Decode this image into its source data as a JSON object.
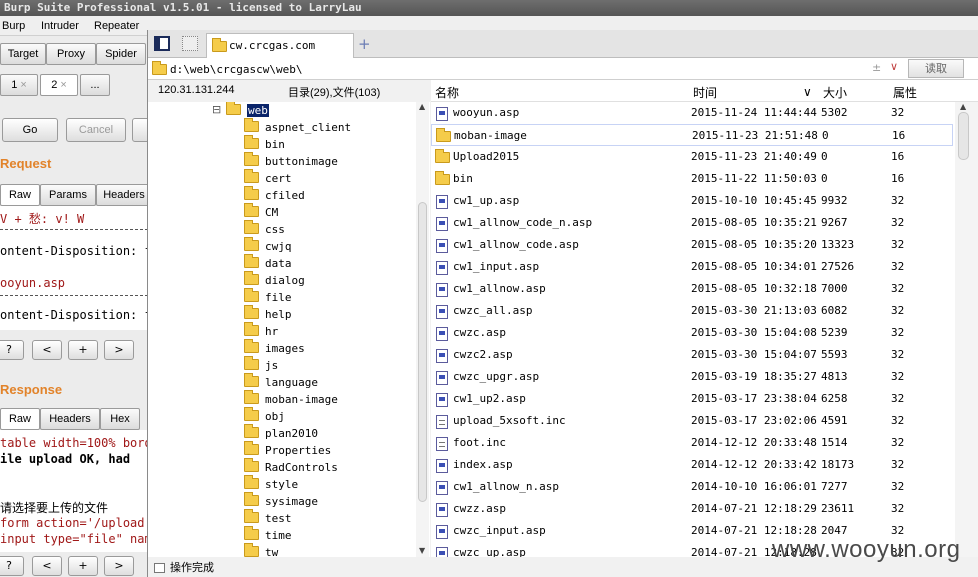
{
  "burp": {
    "title": "Burp Suite Professional v1.5.01 - licensed to LarryLau",
    "menu": [
      "Burp",
      "Intruder",
      "Repeater"
    ],
    "tools": [
      "Target",
      "Proxy",
      "Spider"
    ],
    "repeater_tabs": [
      "1",
      "2",
      "..."
    ],
    "tab_close": "×",
    "go_label": "Go",
    "cancel_label": "Cancel",
    "request_head": "Request",
    "request_tabs": [
      "Raw",
      "Params",
      "Headers"
    ],
    "request_lines": [
      "V   +   愁: v!   W",
      "ontent-Disposition: f",
      "ooyun.asp",
      "ontent-Disposition: f"
    ],
    "nav_buttons": [
      "?",
      "<",
      "+",
      ">"
    ],
    "response_head": "Response",
    "response_tabs": [
      "Raw",
      "Headers",
      "Hex"
    ],
    "response_lines": [
      "table width=100% bord",
      "ile upload OK, had",
      "请选择要上传的文件",
      "form action='/upload.",
      "input type=\"file\" nam"
    ]
  },
  "caidao": {
    "tab_url": "cw.crcgas.com",
    "add_tab": "+",
    "path": "d:\\web\\crcgascw\\web\\",
    "read_label": "读取",
    "ip": "120.31.131.244",
    "summary": "目录(29),文件(103)",
    "tree_expand": "⊟",
    "tree_root": "web",
    "tree": [
      "aspnet_client",
      "bin",
      "buttonimage",
      "cert",
      "cfiled",
      "CM",
      "css",
      "cwjq",
      "data",
      "dialog",
      "file",
      "help",
      "hr",
      "images",
      "js",
      "language",
      "moban-image",
      "obj",
      "plan2010",
      "Properties",
      "RadControls",
      "style",
      "sysimage",
      "test",
      "time",
      "tw"
    ],
    "columns": {
      "name": "名称",
      "time": "时间",
      "size": "大小",
      "attr": "属性"
    },
    "files": [
      {
        "name": "wooyun.asp",
        "time": "2015-11-24 11:44:44",
        "size": "5302",
        "attr": "32",
        "kind": "asp"
      },
      {
        "name": "moban-image",
        "time": "2015-11-23 21:51:48",
        "size": "0",
        "attr": "16",
        "kind": "folder"
      },
      {
        "name": "Upload2015",
        "time": "2015-11-23 21:40:49",
        "size": "0",
        "attr": "16",
        "kind": "folder"
      },
      {
        "name": "bin",
        "time": "2015-11-22 11:50:03",
        "size": "0",
        "attr": "16",
        "kind": "folder"
      },
      {
        "name": "cw1_up.asp",
        "time": "2015-10-10 10:45:45",
        "size": "9932",
        "attr": "32",
        "kind": "asp"
      },
      {
        "name": "cw1_allnow_code_n.asp",
        "time": "2015-08-05 10:35:21",
        "size": "9267",
        "attr": "32",
        "kind": "asp"
      },
      {
        "name": "cw1_allnow_code.asp",
        "time": "2015-08-05 10:35:20",
        "size": "13323",
        "attr": "32",
        "kind": "asp"
      },
      {
        "name": "cw1_input.asp",
        "time": "2015-08-05 10:34:01",
        "size": "27526",
        "attr": "32",
        "kind": "asp"
      },
      {
        "name": "cw1_allnow.asp",
        "time": "2015-08-05 10:32:18",
        "size": "7000",
        "attr": "32",
        "kind": "asp"
      },
      {
        "name": "cwzc_all.asp",
        "time": "2015-03-30 21:13:03",
        "size": "6082",
        "attr": "32",
        "kind": "asp"
      },
      {
        "name": "cwzc.asp",
        "time": "2015-03-30 15:04:08",
        "size": "5239",
        "attr": "32",
        "kind": "asp"
      },
      {
        "name": "cwzc2.asp",
        "time": "2015-03-30 15:04:07",
        "size": "5593",
        "attr": "32",
        "kind": "asp"
      },
      {
        "name": "cwzc_upgr.asp",
        "time": "2015-03-19 18:35:27",
        "size": "4813",
        "attr": "32",
        "kind": "asp"
      },
      {
        "name": "cw1_up2.asp",
        "time": "2015-03-17 23:38:04",
        "size": "6258",
        "attr": "32",
        "kind": "asp"
      },
      {
        "name": "upload_5xsoft.inc",
        "time": "2015-03-17 23:02:06",
        "size": "4591",
        "attr": "32",
        "kind": "inc"
      },
      {
        "name": "foot.inc",
        "time": "2014-12-12 20:33:48",
        "size": "1514",
        "attr": "32",
        "kind": "inc"
      },
      {
        "name": "index.asp",
        "time": "2014-12-12 20:33:42",
        "size": "18173",
        "attr": "32",
        "kind": "asp"
      },
      {
        "name": "cw1_allnow_n.asp",
        "time": "2014-10-10 16:06:01",
        "size": "7277",
        "attr": "32",
        "kind": "asp"
      },
      {
        "name": "cwzz.asp",
        "time": "2014-07-21 12:18:29",
        "size": "23611",
        "attr": "32",
        "kind": "asp"
      },
      {
        "name": "cwzc_input.asp",
        "time": "2014-07-21 12:18:28",
        "size": "2047",
        "attr": "32",
        "kind": "asp"
      },
      {
        "name": "cwzc_up.asp",
        "time": "2014-07-21 12:18:28",
        "size": "",
        "attr": "32",
        "kind": "asp"
      }
    ],
    "status": "操作完成"
  },
  "watermark": "www.wooyun.org"
}
